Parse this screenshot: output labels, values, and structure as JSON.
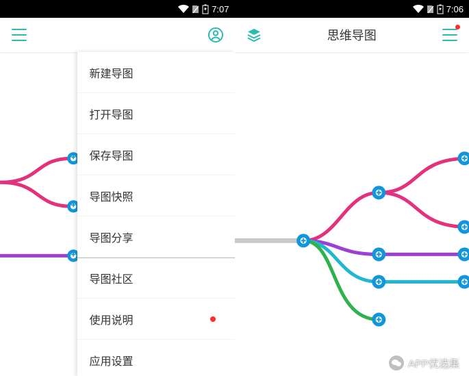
{
  "left": {
    "status": {
      "time": "7:07"
    },
    "menu": {
      "items": [
        {
          "label": "新建导图",
          "dot": false
        },
        {
          "label": "打开导图",
          "dot": false
        },
        {
          "label": "保存导图",
          "dot": false
        },
        {
          "label": "导图快照",
          "dot": false
        },
        {
          "label": "导图分享",
          "dot": false
        },
        {
          "label": "导图社区",
          "dot": false,
          "section": true
        },
        {
          "label": "使用说明",
          "dot": true
        },
        {
          "label": "应用设置",
          "dot": false
        }
      ]
    }
  },
  "right": {
    "status": {
      "time": "7:06"
    },
    "title": "思维导图"
  },
  "colors": {
    "accent": "#2bbcb1",
    "pink": "#e3317d",
    "purple": "#9b3fd6",
    "cyan": "#23b6d0",
    "green": "#2fb24d",
    "node": "#1296db",
    "grey": "#c9c9c9"
  },
  "watermark": "APP优选集"
}
